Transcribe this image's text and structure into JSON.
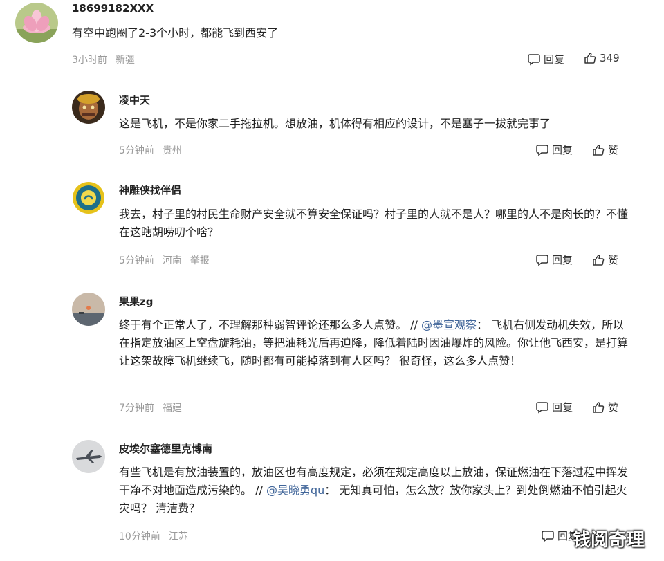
{
  "top": {
    "username": "18699182XXX",
    "text": "有空中跑圈了2-3个小时，都能飞到西安了",
    "time": "3小时前",
    "location": "新疆",
    "reply_label": "回复",
    "like_count": "349"
  },
  "replies": [
    {
      "username": "凌中天",
      "text": "这是飞机，不是你家二手拖拉机。想放油，机体得有相应的设计，不是塞子一拔就完事了",
      "time": "5分钟前",
      "location": "贵州",
      "reply_label": "回复",
      "like_label": "赞"
    },
    {
      "username": "神雕侠找伴侣",
      "text": "我去，村子里的村民生命财产安全就不算安全保证吗？村子里的人就不是人？哪里的人不是肉长的？不懂在这瞎胡唠叨个啥？",
      "time": "5分钟前",
      "location": "河南",
      "report_label": "举报",
      "reply_label": "回复",
      "like_label": "赞"
    },
    {
      "username": "果果zg",
      "text_before": "终于有个正常人了，不理解那种弱智评论还那么多人点赞。 // ",
      "mention": "@墨宣观察",
      "text_after": "： 飞机右侧发动机失效，所以在指定放油区上空盘旋耗油，等把油耗光后再迫降，降低着陆时因油爆炸的风险。你让他飞西安，是打算让这架故障飞机继续飞，随时都有可能掉落到有人区吗？ 很奇怪，这么多人点赞！",
      "time": "7分钟前",
      "location": "福建",
      "reply_label": "回复",
      "like_label": "赞"
    },
    {
      "username": "皮埃尔塞德里克博南",
      "text_before": "有些飞机是有放油装置的，放油区也有高度规定，必须在规定高度以上放油，保证燃油在下落过程中挥发干净不对地面造成污染的。 // ",
      "mention": "@吴晓勇qu",
      "text_after": "： 无知真可怕，怎么放？放你家头上？到处倒燃油不怕引起火灾吗？ 清洁费？",
      "time": "10分钟前",
      "location": "江苏",
      "reply_label": "回复"
    }
  ],
  "watermark": "钱阅奇理",
  "colors": {
    "mention": "#406599",
    "meta": "#9a9a9a",
    "text": "#222222"
  }
}
